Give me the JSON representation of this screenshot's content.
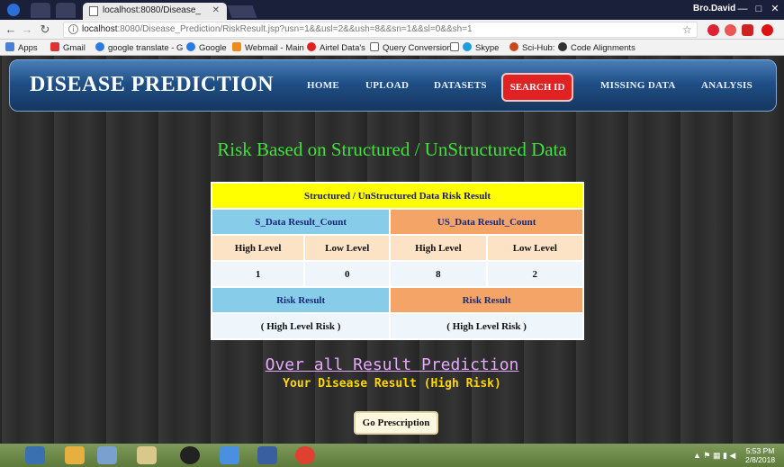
{
  "browser": {
    "tab_title": "localhost:8080/Disease_",
    "url_host": "localhost",
    "url_rest": ":8080/Disease_Prediction/RiskResult.jsp?usn=1&&usl=2&&ush=8&&sn=1&&sl=0&&sh=1",
    "user": "Bro.David",
    "bookmarks": [
      "Apps",
      "Gmail",
      "google translate - G",
      "Google",
      "Webmail - Main",
      "Airtel Data's",
      "Query Conversion",
      "Skype",
      "Sci-Hub:",
      "Code Alignments"
    ]
  },
  "header": {
    "brand": "DISEASE PREDICTION",
    "nav": [
      "HOME",
      "UPLOAD",
      "DATASETS",
      "SEARCH ID",
      "MISSING DATA",
      "ANALYSIS"
    ],
    "active": "SEARCH ID"
  },
  "main": {
    "title": "Risk Based on Structured / UnStructured Data",
    "table": {
      "caption": "Structured / UnStructured Data Risk Result",
      "s_header": "S_Data Result_Count",
      "us_header": "US_Data Result_Count",
      "high_label": "High Level",
      "low_label": "Low Level",
      "s_high": "1",
      "s_low": "0",
      "us_high": "8",
      "us_low": "2",
      "risk_label": "Risk Result",
      "s_risk": "( High Level Risk )",
      "us_risk": "( High Level Risk )"
    },
    "overall_title": "Over all Result Prediction",
    "disease_result": "Your Disease Result (High Risk)",
    "go_button": "Go Prescription"
  },
  "taskbar": {
    "time": "5:53 PM",
    "date": "2/8/2018"
  }
}
